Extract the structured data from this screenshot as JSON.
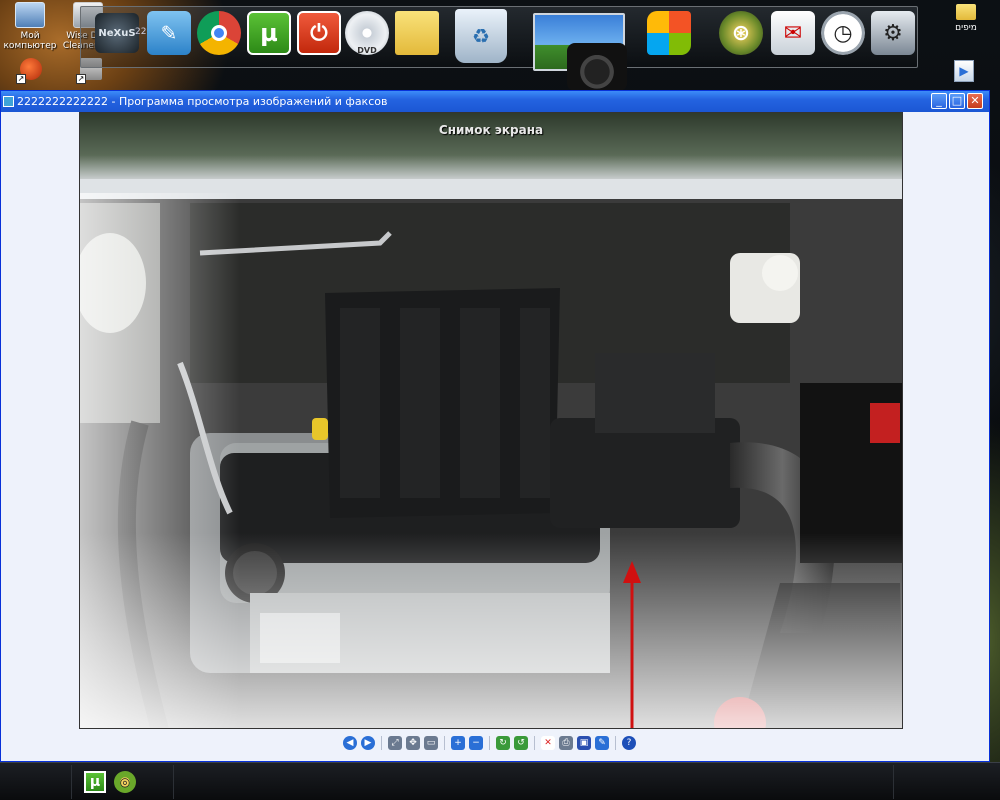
{
  "desktop": {
    "icons": [
      {
        "label": "Мой компьютер",
        "name": "my-computer-icon"
      },
      {
        "label": "Wise Disk Cleaner P...",
        "name": "wise-disk-cleaner-icon"
      }
    ],
    "right_icons": [
      {
        "label": "מיפים",
        "name": "folder-icon"
      }
    ]
  },
  "dock": {
    "partial_label": "222",
    "items": [
      {
        "name": "nexus-icon",
        "glyph": "NeXuS"
      },
      {
        "name": "edit-icon",
        "glyph": "✎"
      },
      {
        "name": "chrome-icon",
        "glyph": "◉"
      },
      {
        "name": "utorrent-icon",
        "glyph": "µ"
      },
      {
        "name": "power-icon",
        "glyph": "⏻"
      },
      {
        "name": "dvd-icon",
        "glyph": "DVD"
      },
      {
        "name": "folder-icon",
        "glyph": ""
      },
      {
        "name": "recycle-bin-icon",
        "glyph": "♻"
      },
      {
        "name": "desktop-preview-icon",
        "glyph": ""
      },
      {
        "name": "windows-icon",
        "glyph": "⊞"
      },
      {
        "name": "network-icon",
        "glyph": "⊛"
      },
      {
        "name": "mail-icon",
        "glyph": "✉"
      },
      {
        "name": "clock-icon",
        "glyph": "◷"
      },
      {
        "name": "settings-icon",
        "glyph": "⚙"
      }
    ]
  },
  "window": {
    "title": "2222222222222 - Программа просмотра изображений и факсов",
    "minimize": "_",
    "maximize": "□",
    "close": "✕",
    "photo_caption": "Снимок экрана"
  },
  "viewer_toolbar": [
    {
      "name": "previous-image-icon",
      "glyph": "◀",
      "color": "#2a6fd6"
    },
    {
      "name": "next-image-icon",
      "glyph": "▶",
      "color": "#2a6fd6"
    },
    {
      "name": "best-fit-icon",
      "glyph": "⤢",
      "color": "#6b7a90"
    },
    {
      "name": "actual-size-icon",
      "glyph": "✥",
      "color": "#6b7a90"
    },
    {
      "name": "slideshow-icon",
      "glyph": "▭",
      "color": "#6b7a90"
    },
    {
      "name": "zoom-in-icon",
      "glyph": "+",
      "color": "#2a6fd6"
    },
    {
      "name": "zoom-out-icon",
      "glyph": "−",
      "color": "#2a6fd6"
    },
    {
      "name": "rotate-clockwise-icon",
      "glyph": "↻",
      "color": "#3a9a3a"
    },
    {
      "name": "rotate-counterclockwise-icon",
      "glyph": "↺",
      "color": "#3a9a3a"
    },
    {
      "name": "delete-icon",
      "glyph": "✕",
      "color": "#d22"
    },
    {
      "name": "print-icon",
      "glyph": "⎙",
      "color": "#6b7a90"
    },
    {
      "name": "save-icon",
      "glyph": "▣",
      "color": "#2a4fb0"
    },
    {
      "name": "edit-image-icon",
      "glyph": "✎",
      "color": "#2a6fd6"
    },
    {
      "name": "help-icon",
      "glyph": "?",
      "color": "#1d4fb8"
    }
  ],
  "taskbar": {
    "items": [
      {
        "name": "utorrent-taskbar-icon",
        "glyph": "µ"
      },
      {
        "name": "browser-taskbar-icon",
        "glyph": "◎"
      }
    ]
  },
  "colors": {
    "titlebar": "#2463e0",
    "window_bg": "#eef2fb",
    "arrow": "#d01010"
  }
}
